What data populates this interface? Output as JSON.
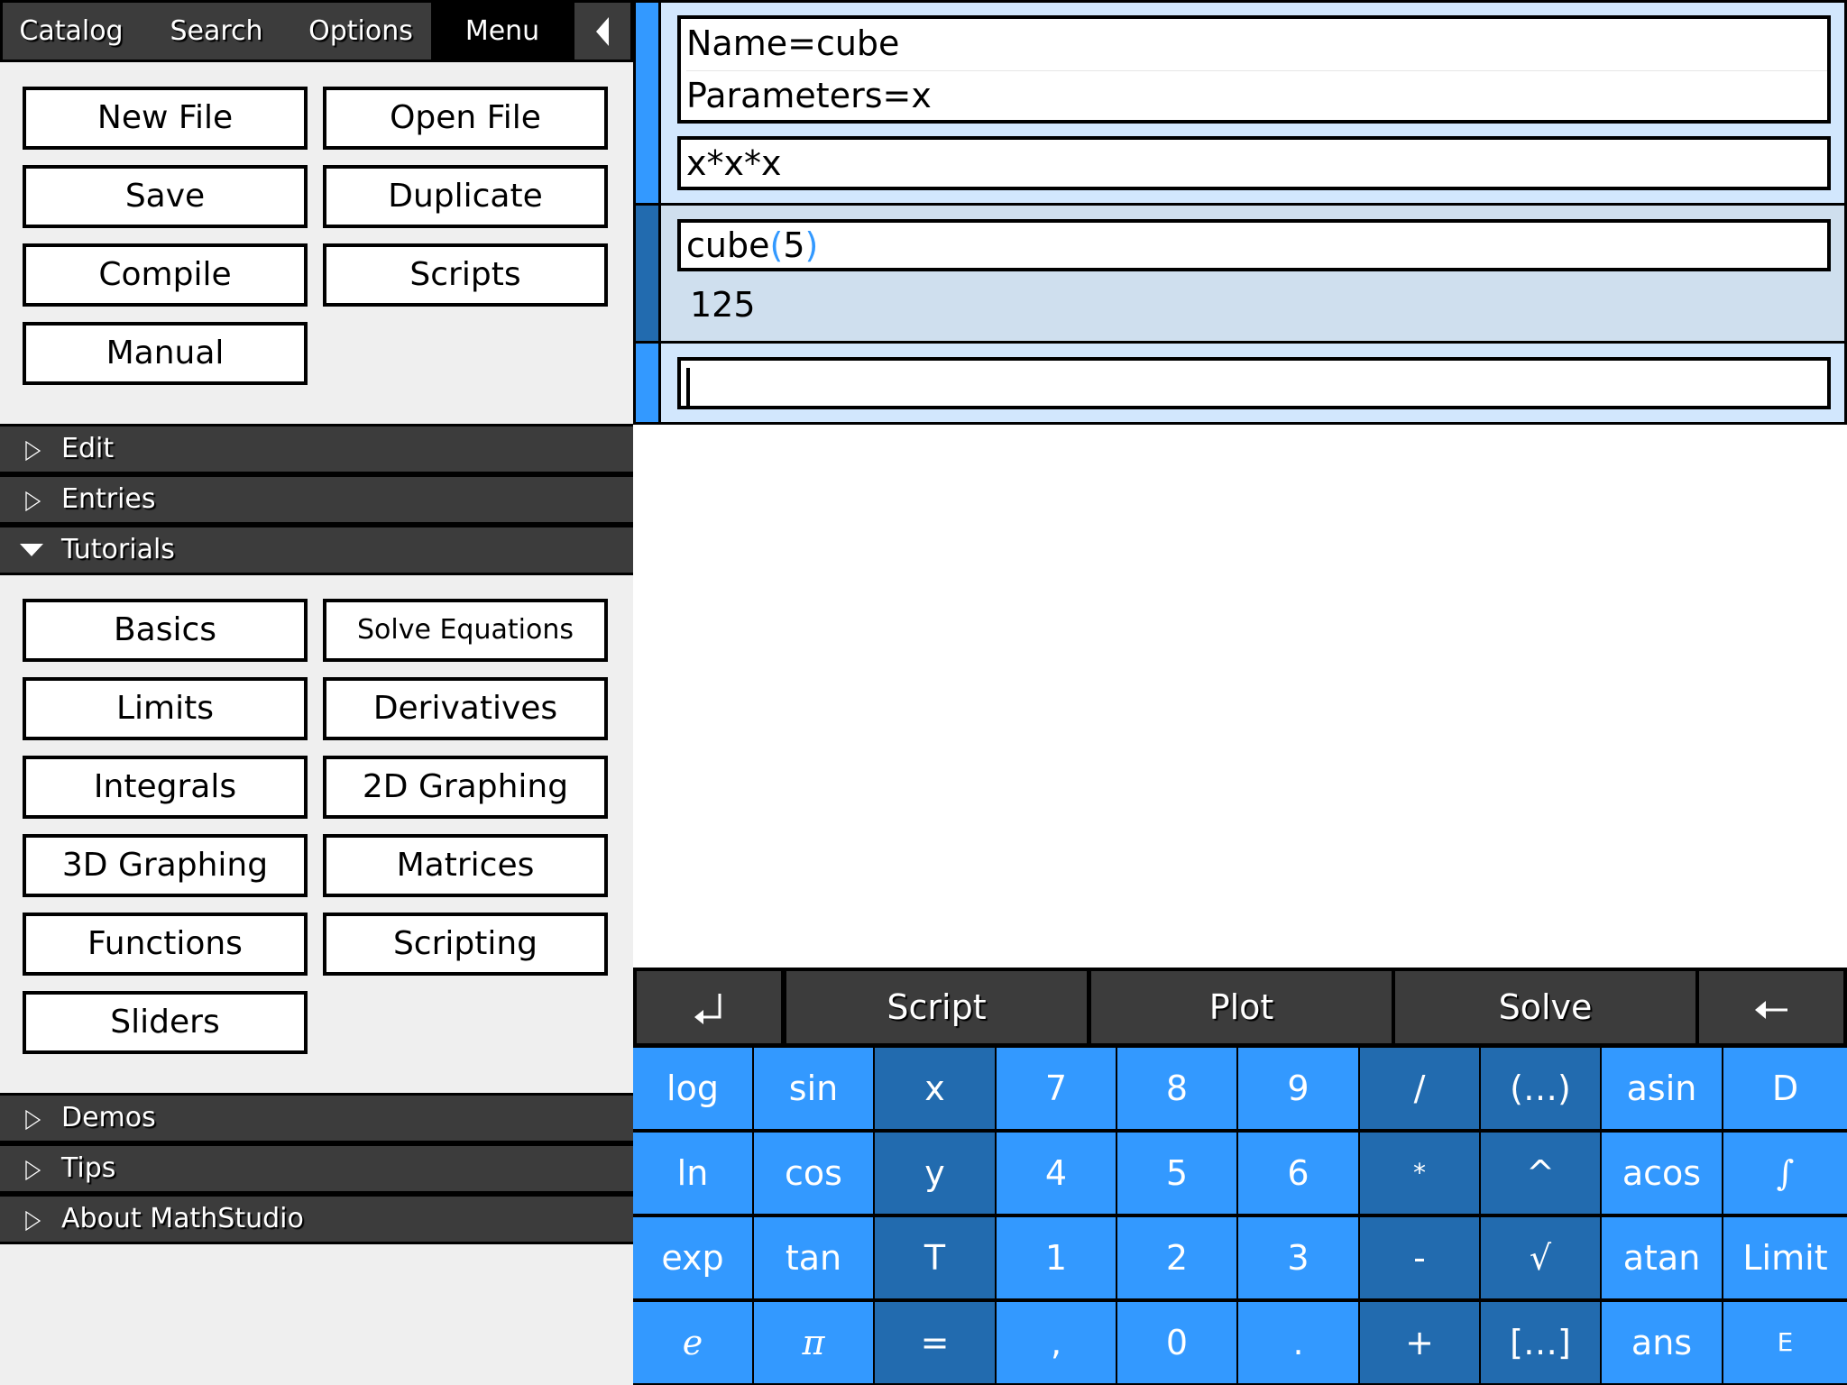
{
  "sidebar": {
    "tabs": [
      {
        "label": "Catalog",
        "active": false
      },
      {
        "label": "Search",
        "active": false
      },
      {
        "label": "Options",
        "active": false
      },
      {
        "label": "Menu",
        "active": true
      }
    ],
    "collapse_icon": "chevron-left-icon",
    "file_buttons": [
      "New File",
      "Open File",
      "Save",
      "Duplicate",
      "Compile",
      "Scripts",
      "Manual"
    ],
    "sections": [
      {
        "label": "Edit",
        "expanded": false
      },
      {
        "label": "Entries",
        "expanded": false
      },
      {
        "label": "Tutorials",
        "expanded": true
      },
      {
        "label": "Demos",
        "expanded": false
      },
      {
        "label": "Tips",
        "expanded": false
      },
      {
        "label": "About MathStudio",
        "expanded": false
      }
    ],
    "tutorial_buttons": [
      "Basics",
      "Solve Equations",
      "Limits",
      "Derivatives",
      "Integrals",
      "2D Graphing",
      "3D Graphing",
      "Matrices",
      "Functions",
      "Scripting",
      "Sliders"
    ]
  },
  "notebook": {
    "entries": [
      {
        "type": "function",
        "name_line": "Name=cube",
        "params_line": "Parameters=x",
        "body": "x*x*x"
      },
      {
        "type": "expression",
        "input_prefix": "cube",
        "input_open": "(",
        "input_arg": "5",
        "input_close": ")",
        "result": "125"
      },
      {
        "type": "expression",
        "input": "",
        "active": true
      }
    ]
  },
  "toolbar": {
    "enter_icon": "return-arrow-icon",
    "buttons": [
      "Script",
      "Plot",
      "Solve"
    ],
    "backspace_icon": "left-arrow-icon"
  },
  "keypad": {
    "rows": [
      [
        "log",
        "sin",
        "x",
        "7",
        "8",
        "9",
        "/",
        "(…)",
        "asin",
        "D"
      ],
      [
        "ln",
        "cos",
        "y",
        "4",
        "5",
        "6",
        "*",
        "^",
        "acos",
        "∫"
      ],
      [
        "exp",
        "tan",
        "T",
        "1",
        "2",
        "3",
        "-",
        "√",
        "atan",
        "Limit"
      ],
      [
        "e",
        "π",
        "=",
        ",",
        "0",
        ".",
        "+",
        "[…]",
        "ans",
        "E"
      ]
    ]
  },
  "colors": {
    "key_light": "#3399ff",
    "key_dark": "#226baf",
    "panel_dark": "#3c3c3c",
    "entry_bg": "#d2e7fd",
    "entry_result_bg": "#cfdfee",
    "gutter_active": "#3399ff",
    "gutter_result": "#226baf"
  }
}
